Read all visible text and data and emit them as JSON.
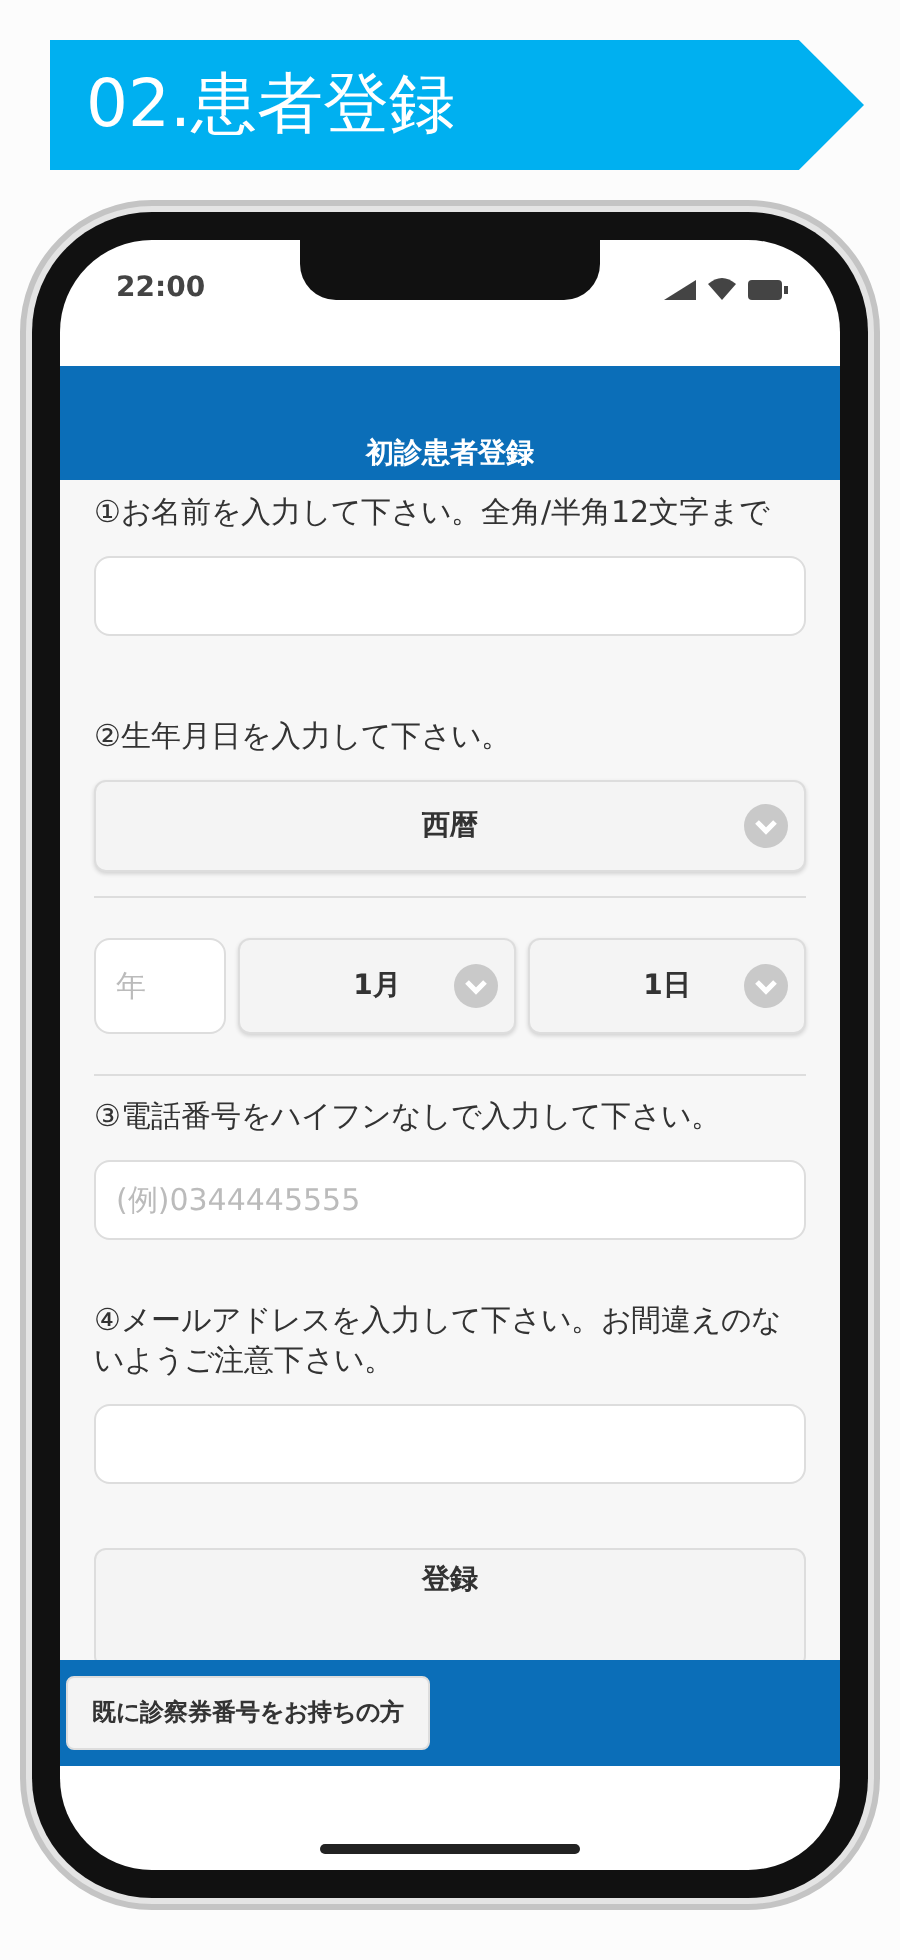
{
  "banner": {
    "title": "02.患者登録"
  },
  "phone": {
    "status_bar": {
      "time": "22:00"
    },
    "header": {
      "title": "初診患者登録"
    },
    "form": [
      {
        "kind": "text",
        "label": "①お名前を入力して下さい。全角/半角12文字まで"
      },
      {
        "kind": "date",
        "label": "②生年月日を入力して下さい。",
        "era": "西暦",
        "year_placeholder": "年",
        "month": "1月",
        "day": "1日"
      },
      {
        "kind": "text",
        "label": "③電話番号をハイフンなしで入力して下さい。",
        "placeholder": "(例)0344445555"
      },
      {
        "kind": "text",
        "label": "④メールアドレスを入力して下さい。お間違えのないようご注意下さい。"
      }
    ],
    "submit": "登録",
    "footer_button": "既に診察券番号をお持ちの方"
  }
}
